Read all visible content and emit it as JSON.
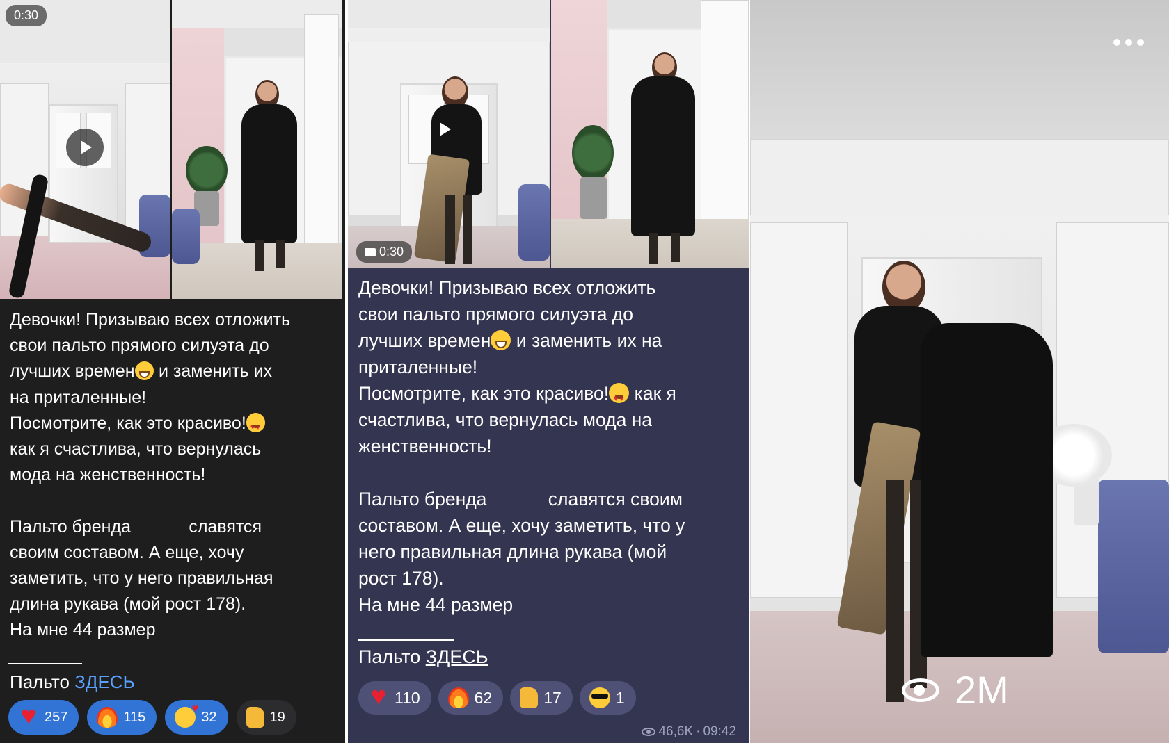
{
  "panel1": {
    "video_duration": "0:30",
    "post_text": "Девочки! Призываю всех отложить\nсвои пальто прямого силуэта до\nлучших времен",
    "post_text_b": " и заменить их\nна приталенные!\nПосмотрите, как это красиво!",
    "post_text_c": "\nкак я счастлива, что вернулась\nмода на женственность!\n\nПальто бренда            славятся\nсвоим составом. А еще, хочу\nзаметить, что у него правильная\nдлина рукава (мой рост 178).\nНа мне 44 размер",
    "coat_prefix": "Пальто ",
    "coat_link": "ЗДЕСЬ",
    "reactions": [
      {
        "icon": "heart-icon",
        "count": "257"
      },
      {
        "icon": "fire-icon",
        "count": "115"
      },
      {
        "icon": "smiling-face-with-hearts-icon",
        "count": "32"
      },
      {
        "icon": "thumbs-up-icon",
        "count": "19"
      }
    ]
  },
  "panel2": {
    "video_duration": "0:30",
    "post_text": "Девочки! Призываю всех отложить\nсвои пальто прямого силуэта до\nлучших времен",
    "post_text_b": " и заменить их на\nприталенные!\nПосмотрите, как это красиво!",
    "post_text_c": " как я\nсчастлива, что вернулась мода на\nженственность!\n\nПальто бренда            славятся своим\nсоставом. А еще, хочу заметить, что у\nнего правильная длина рукава (мой\nрост 178).\nНа мне 44 размер",
    "coat_prefix": "Пальто ",
    "coat_link": "ЗДЕСЬ",
    "reactions": [
      {
        "icon": "heart-icon",
        "count": "110"
      },
      {
        "icon": "fire-icon",
        "count": "62"
      },
      {
        "icon": "thumbs-up-icon",
        "count": "17"
      },
      {
        "icon": "smiling-face-with-sunglasses-icon",
        "count": "1"
      }
    ],
    "views": "46,6K",
    "time": "09:42"
  },
  "panel3": {
    "views": "2M"
  },
  "colors": {
    "panel1_bg": "#1e1e1f",
    "panel2_bg": "#343651",
    "link_blue": "#5aa0ff",
    "reaction_blue": "#3174d6"
  }
}
